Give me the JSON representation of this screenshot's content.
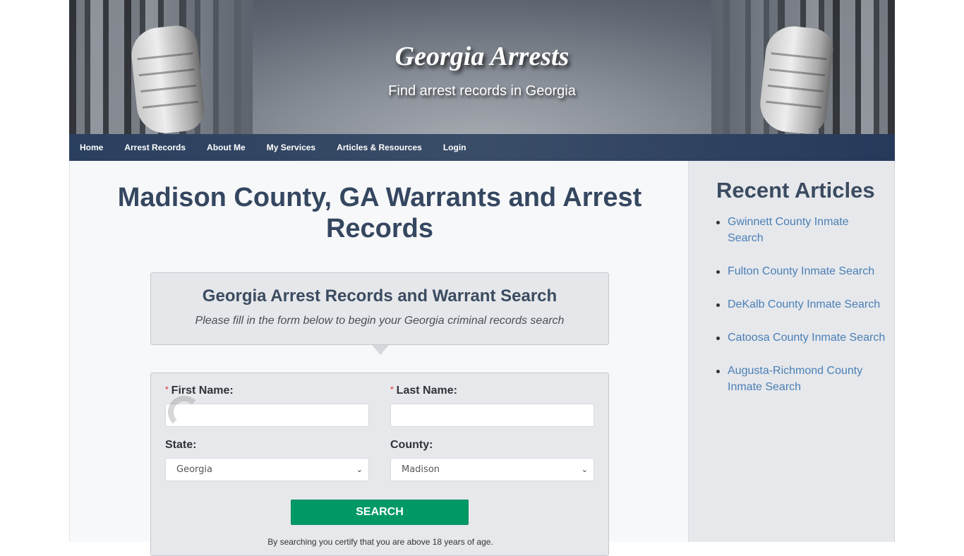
{
  "header": {
    "site_title": "Georgia Arrests",
    "tagline": "Find arrest records in Georgia"
  },
  "nav": {
    "items": [
      {
        "label": "Home"
      },
      {
        "label": "Arrest Records"
      },
      {
        "label": "About Me"
      },
      {
        "label": "My Services"
      },
      {
        "label": "Articles & Resources"
      },
      {
        "label": "Login"
      }
    ]
  },
  "main": {
    "page_title": "Madison County, GA Warrants and Arrest Records",
    "intro": {
      "title": "Georgia Arrest Records and Warrant Search",
      "subtitle": "Please fill in the form below to begin your Georgia criminal records search"
    },
    "form": {
      "required_marker": "*",
      "first_name_label": "First Name:",
      "first_name_value": "",
      "last_name_label": "Last Name:",
      "last_name_value": "",
      "state_label": "State:",
      "state_value": "Georgia",
      "county_label": "County:",
      "county_value": "Madison",
      "search_label": "SEARCH",
      "disclaimer": "By searching you certify that you are above 18 years of age."
    }
  },
  "sidebar": {
    "title": "Recent Articles",
    "articles": [
      {
        "label": "Gwinnett County Inmate Search"
      },
      {
        "label": "Fulton County Inmate Search"
      },
      {
        "label": "DeKalb County Inmate Search"
      },
      {
        "label": "Catoosa County Inmate Search"
      },
      {
        "label": "Augusta-Richmond County Inmate Search"
      }
    ]
  },
  "colors": {
    "nav_bg": "#34475f",
    "heading": "#354760",
    "link": "#4a7fb5",
    "search_button": "#009966",
    "required": "#e3262d"
  }
}
